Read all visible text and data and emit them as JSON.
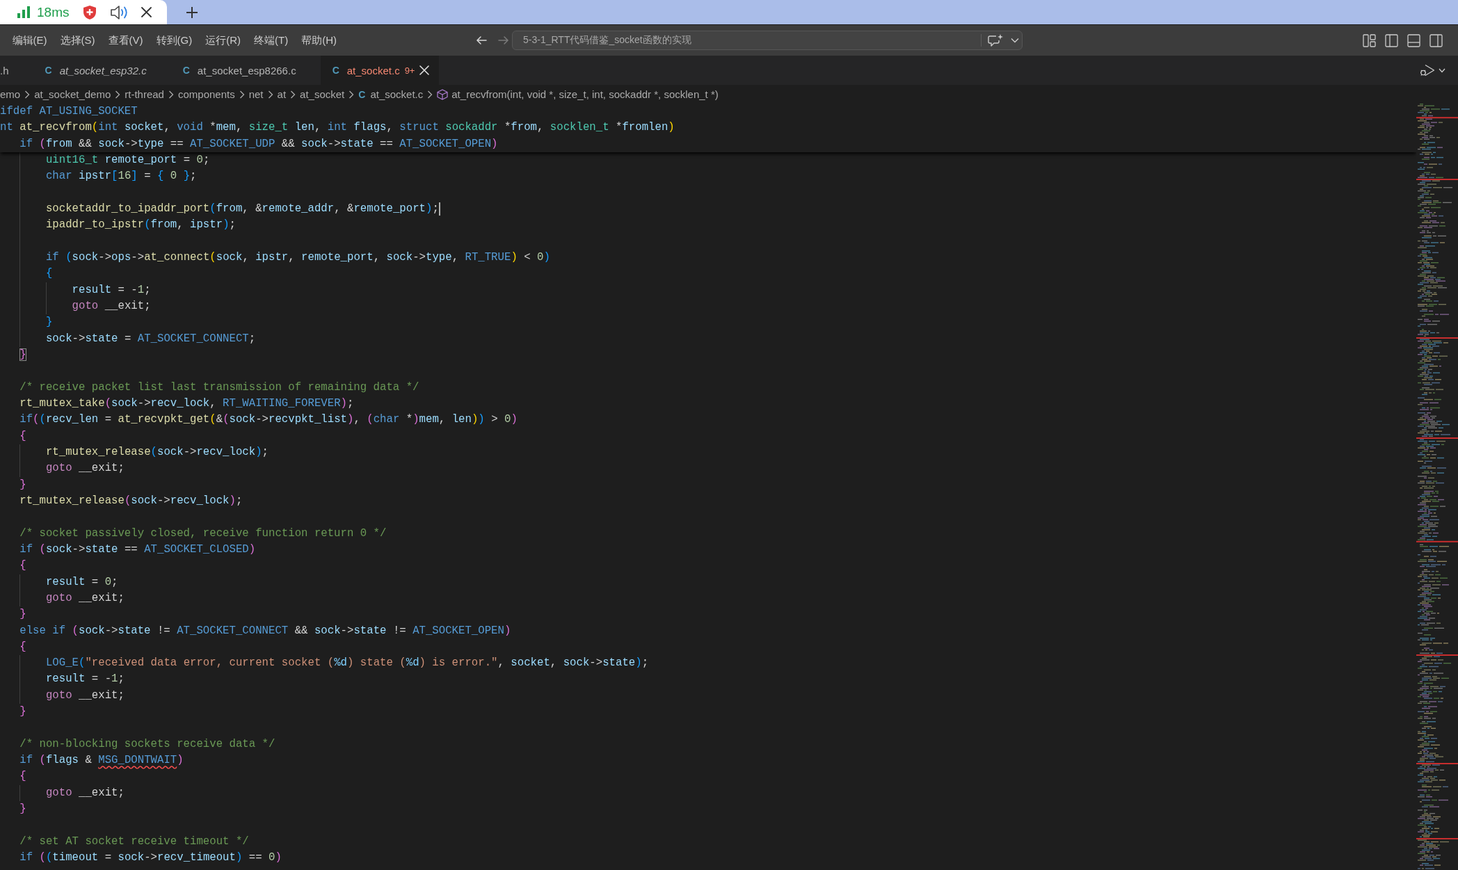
{
  "browser_tab": {
    "latency": "18ms"
  },
  "menu": [
    "编辑(E)",
    "选择(S)",
    "查看(V)",
    "转到(G)",
    "运行(R)",
    "终端(T)",
    "帮助(H)"
  ],
  "navigation": [
    {
      "kind": "back",
      "disabled": false
    },
    {
      "kind": "forward",
      "disabled": true
    }
  ],
  "command_center": {
    "title": "5-3-1_RTT代码借鉴_socket函数的实现"
  },
  "tabs": [
    {
      "label": ".h",
      "selected": false,
      "preview": false,
      "errors": false
    },
    {
      "icon": "C",
      "label": "at_socket_esp32.c",
      "selected": false,
      "preview": true,
      "errors": false
    },
    {
      "icon": "C",
      "label": "at_socket_esp8266.c",
      "selected": false,
      "preview": false,
      "errors": false
    },
    {
      "icon": "C",
      "label": "at_socket.c",
      "problems": "9+",
      "selected": true,
      "preview": false,
      "errors": true
    }
  ],
  "breadcrumbs": [
    {
      "kind": "folder",
      "label": "emo"
    },
    {
      "kind": "folder",
      "label": "at_socket_demo"
    },
    {
      "kind": "folder",
      "label": "rt-thread"
    },
    {
      "kind": "folder",
      "label": "components"
    },
    {
      "kind": "folder",
      "label": "net"
    },
    {
      "kind": "folder",
      "label": "at"
    },
    {
      "kind": "folder",
      "label": "at_socket"
    },
    {
      "kind": "file",
      "icon": "C",
      "label": "at_socket.c"
    },
    {
      "kind": "symbol",
      "label": "at_recvfrom(int, void *, size_t, int, sockaddr *, socklen_t *)"
    }
  ],
  "editor": {
    "sticky_lines": [
      {
        "tokens": [
          {
            "kind": "kw",
            "text": "ifdef AT_USING_SOCKET"
          }
        ]
      },
      {
        "tokens": [
          {
            "kind": "kw",
            "text": "nt "
          },
          {
            "kind": "fn",
            "text": "at_recvfrom"
          },
          {
            "kind": "b1",
            "text": "("
          },
          {
            "kind": "kw",
            "text": "int "
          },
          {
            "kind": "var",
            "text": "socket"
          },
          {
            "kind": "plain",
            "text": ", "
          },
          {
            "kind": "kw",
            "text": "void"
          },
          {
            "kind": "plain",
            "text": " *"
          },
          {
            "kind": "var",
            "text": "mem"
          },
          {
            "kind": "plain",
            "text": ", "
          },
          {
            "kind": "type",
            "text": "size_t "
          },
          {
            "kind": "var",
            "text": "len"
          },
          {
            "kind": "plain",
            "text": ", "
          },
          {
            "kind": "kw",
            "text": "int "
          },
          {
            "kind": "var",
            "text": "flags"
          },
          {
            "kind": "plain",
            "text": ", "
          },
          {
            "kind": "kw",
            "text": "struct "
          },
          {
            "kind": "type",
            "text": "sockaddr"
          },
          {
            "kind": "plain",
            "text": " *"
          },
          {
            "kind": "var",
            "text": "from"
          },
          {
            "kind": "plain",
            "text": ", "
          },
          {
            "kind": "type",
            "text": "socklen_t"
          },
          {
            "kind": "plain",
            "text": " *"
          },
          {
            "kind": "var",
            "text": "fromlen"
          },
          {
            "kind": "b1",
            "text": ")"
          }
        ]
      },
      {
        "tokens": [
          {
            "kind": "kw",
            "text": "   if "
          },
          {
            "kind": "b2",
            "text": "("
          },
          {
            "kind": "var",
            "text": "from"
          },
          {
            "kind": "plain",
            "text": " && "
          },
          {
            "kind": "var",
            "text": "sock"
          },
          {
            "kind": "plain",
            "text": "->"
          },
          {
            "kind": "var",
            "text": "type"
          },
          {
            "kind": "plain",
            "text": " == "
          },
          {
            "kind": "kw",
            "text": "AT_SOCKET_UDP"
          },
          {
            "kind": "plain",
            "text": " && "
          },
          {
            "kind": "var",
            "text": "sock"
          },
          {
            "kind": "plain",
            "text": "->"
          },
          {
            "kind": "var",
            "text": "state"
          },
          {
            "kind": "plain",
            "text": " == "
          },
          {
            "kind": "kw",
            "text": "AT_SOCKET_OPEN"
          },
          {
            "kind": "b2",
            "text": ")"
          }
        ]
      }
    ],
    "lines": [
      {
        "current": false,
        "tokens": [
          {
            "kind": "type",
            "text": "       uint16_t "
          },
          {
            "kind": "var",
            "text": "remote_port"
          },
          {
            "kind": "plain",
            "text": " = "
          },
          {
            "kind": "num",
            "text": "0"
          },
          {
            "kind": "plain",
            "text": ";"
          }
        ]
      },
      {
        "current": false,
        "tokens": [
          {
            "kind": "kw",
            "text": "       char "
          },
          {
            "kind": "var",
            "text": "ipstr"
          },
          {
            "kind": "b3",
            "text": "["
          },
          {
            "kind": "num",
            "text": "16"
          },
          {
            "kind": "b3",
            "text": "]"
          },
          {
            "kind": "plain",
            "text": " = "
          },
          {
            "kind": "b3",
            "text": "{"
          },
          {
            "kind": "num",
            "text": " 0 "
          },
          {
            "kind": "b3",
            "text": "}"
          },
          {
            "kind": "plain",
            "text": ";"
          }
        ]
      },
      {
        "current": false
      },
      {
        "current": true,
        "tokens": [
          {
            "kind": "fn",
            "text": "       socketaddr_to_ipaddr_port"
          },
          {
            "kind": "b3",
            "text": "("
          },
          {
            "kind": "var",
            "text": "from"
          },
          {
            "kind": "plain",
            "text": ", &"
          },
          {
            "kind": "var",
            "text": "remote_addr"
          },
          {
            "kind": "plain",
            "text": ", &"
          },
          {
            "kind": "var",
            "text": "remote_port"
          },
          {
            "kind": "b3",
            "text": ")"
          },
          {
            "kind": "plain",
            "text": ";"
          }
        ]
      },
      {
        "current": false,
        "tokens": [
          {
            "kind": "fn",
            "text": "       ipaddr_to_ipstr"
          },
          {
            "kind": "b3",
            "text": "("
          },
          {
            "kind": "var",
            "text": "from"
          },
          {
            "kind": "plain",
            "text": ", "
          },
          {
            "kind": "var",
            "text": "ipstr"
          },
          {
            "kind": "b3",
            "text": ")"
          },
          {
            "kind": "plain",
            "text": ";"
          }
        ]
      },
      {
        "current": false
      },
      {
        "current": false,
        "tokens": [
          {
            "kind": "kw",
            "text": "       if "
          },
          {
            "kind": "b3",
            "text": "("
          },
          {
            "kind": "var",
            "text": "sock"
          },
          {
            "kind": "plain",
            "text": "->"
          },
          {
            "kind": "var",
            "text": "ops"
          },
          {
            "kind": "plain",
            "text": "->"
          },
          {
            "kind": "fn",
            "text": "at_connect"
          },
          {
            "kind": "b1",
            "text": "("
          },
          {
            "kind": "var",
            "text": "sock"
          },
          {
            "kind": "plain",
            "text": ", "
          },
          {
            "kind": "var",
            "text": "ipstr"
          },
          {
            "kind": "plain",
            "text": ", "
          },
          {
            "kind": "var",
            "text": "remote_port"
          },
          {
            "kind": "plain",
            "text": ", "
          },
          {
            "kind": "var",
            "text": "sock"
          },
          {
            "kind": "plain",
            "text": "->"
          },
          {
            "kind": "var",
            "text": "type"
          },
          {
            "kind": "plain",
            "text": ", "
          },
          {
            "kind": "kw",
            "text": "RT_TRUE"
          },
          {
            "kind": "b1",
            "text": ")"
          },
          {
            "kind": "plain",
            "text": " < "
          },
          {
            "kind": "num",
            "text": "0"
          },
          {
            "kind": "b3",
            "text": ")"
          }
        ]
      },
      {
        "current": false,
        "tokens": [
          {
            "kind": "b3",
            "text": "       {"
          }
        ]
      },
      {
        "current": false,
        "tokens": [
          {
            "kind": "var",
            "text": "           result"
          },
          {
            "kind": "plain",
            "text": " = -"
          },
          {
            "kind": "num",
            "text": "1"
          },
          {
            "kind": "plain",
            "text": ";"
          }
        ]
      },
      {
        "current": false,
        "tokens": [
          {
            "kind": "ctl",
            "text": "           goto"
          },
          {
            "kind": "plain",
            "text": " __exit;"
          }
        ]
      },
      {
        "current": false,
        "tokens": [
          {
            "kind": "b3",
            "text": "       }"
          }
        ]
      },
      {
        "current": false,
        "tokens": [
          {
            "kind": "var",
            "text": "       sock"
          },
          {
            "kind": "plain",
            "text": "->"
          },
          {
            "kind": "var",
            "text": "state"
          },
          {
            "kind": "plain",
            "text": " = "
          },
          {
            "kind": "kw",
            "text": "AT_SOCKET_CONNECT"
          },
          {
            "kind": "plain",
            "text": ";"
          }
        ]
      },
      {
        "current": false,
        "tokens": [
          {
            "kind": "match",
            "text": "   }"
          }
        ]
      },
      {
        "current": false
      },
      {
        "current": false,
        "tokens": [
          {
            "kind": "cmt",
            "text": "   /* receive packet list last transmission of remaining data */"
          }
        ]
      },
      {
        "current": false,
        "tokens": [
          {
            "kind": "fn",
            "text": "   rt_mutex_take"
          },
          {
            "kind": "b2",
            "text": "("
          },
          {
            "kind": "var",
            "text": "sock"
          },
          {
            "kind": "plain",
            "text": "->"
          },
          {
            "kind": "var",
            "text": "recv_lock"
          },
          {
            "kind": "plain",
            "text": ", "
          },
          {
            "kind": "kw",
            "text": "RT_WAITING_FOREVER"
          },
          {
            "kind": "b2",
            "text": ")"
          },
          {
            "kind": "plain",
            "text": ";"
          }
        ]
      },
      {
        "current": false,
        "tokens": [
          {
            "kind": "kw",
            "text": "   if"
          },
          {
            "kind": "b2",
            "text": "("
          },
          {
            "kind": "b3",
            "text": "("
          },
          {
            "kind": "var",
            "text": "recv_len"
          },
          {
            "kind": "plain",
            "text": " = "
          },
          {
            "kind": "fn",
            "text": "at_recvpkt_get"
          },
          {
            "kind": "b1",
            "text": "("
          },
          {
            "kind": "plain",
            "text": "&"
          },
          {
            "kind": "b2",
            "text": "("
          },
          {
            "kind": "var",
            "text": "sock"
          },
          {
            "kind": "plain",
            "text": "->"
          },
          {
            "kind": "var",
            "text": "recvpkt_list"
          },
          {
            "kind": "b2",
            "text": ")"
          },
          {
            "kind": "plain",
            "text": ", "
          },
          {
            "kind": "b2",
            "text": "("
          },
          {
            "kind": "kw",
            "text": "char"
          },
          {
            "kind": "plain",
            "text": " *"
          },
          {
            "kind": "b2",
            "text": ")"
          },
          {
            "kind": "var",
            "text": "mem"
          },
          {
            "kind": "plain",
            "text": ", "
          },
          {
            "kind": "var",
            "text": "len"
          },
          {
            "kind": "b1",
            "text": ")"
          },
          {
            "kind": "b3",
            "text": ")"
          },
          {
            "kind": "plain",
            "text": " > "
          },
          {
            "kind": "num",
            "text": "0"
          },
          {
            "kind": "b2",
            "text": ")"
          }
        ]
      },
      {
        "current": false,
        "tokens": [
          {
            "kind": "b2",
            "text": "   {"
          }
        ]
      },
      {
        "current": false,
        "tokens": [
          {
            "kind": "fn",
            "text": "       rt_mutex_release"
          },
          {
            "kind": "b3",
            "text": "("
          },
          {
            "kind": "var",
            "text": "sock"
          },
          {
            "kind": "plain",
            "text": "->"
          },
          {
            "kind": "var",
            "text": "recv_lock"
          },
          {
            "kind": "b3",
            "text": ")"
          },
          {
            "kind": "plain",
            "text": ";"
          }
        ]
      },
      {
        "current": false,
        "tokens": [
          {
            "kind": "ctl",
            "text": "       goto"
          },
          {
            "kind": "plain",
            "text": " __exit;"
          }
        ]
      },
      {
        "current": false,
        "tokens": [
          {
            "kind": "b2",
            "text": "   }"
          }
        ]
      },
      {
        "current": false,
        "tokens": [
          {
            "kind": "fn",
            "text": "   rt_mutex_release"
          },
          {
            "kind": "b2",
            "text": "("
          },
          {
            "kind": "var",
            "text": "sock"
          },
          {
            "kind": "plain",
            "text": "->"
          },
          {
            "kind": "var",
            "text": "recv_lock"
          },
          {
            "kind": "b2",
            "text": ")"
          },
          {
            "kind": "plain",
            "text": ";"
          }
        ]
      },
      {
        "current": false
      },
      {
        "current": false,
        "tokens": [
          {
            "kind": "cmt",
            "text": "   /* socket passively closed, receive function return 0 */"
          }
        ]
      },
      {
        "current": false,
        "tokens": [
          {
            "kind": "kw",
            "text": "   if "
          },
          {
            "kind": "b2",
            "text": "("
          },
          {
            "kind": "var",
            "text": "sock"
          },
          {
            "kind": "plain",
            "text": "->"
          },
          {
            "kind": "var",
            "text": "state"
          },
          {
            "kind": "plain",
            "text": " == "
          },
          {
            "kind": "kw",
            "text": "AT_SOCKET_CLOSED"
          },
          {
            "kind": "b2",
            "text": ")"
          }
        ]
      },
      {
        "current": false,
        "tokens": [
          {
            "kind": "b2",
            "text": "   {"
          }
        ]
      },
      {
        "current": false,
        "tokens": [
          {
            "kind": "var",
            "text": "       result"
          },
          {
            "kind": "plain",
            "text": " = "
          },
          {
            "kind": "num",
            "text": "0"
          },
          {
            "kind": "plain",
            "text": ";"
          }
        ]
      },
      {
        "current": false,
        "tokens": [
          {
            "kind": "ctl",
            "text": "       goto"
          },
          {
            "kind": "plain",
            "text": " __exit;"
          }
        ]
      },
      {
        "current": false,
        "tokens": [
          {
            "kind": "b2",
            "text": "   }"
          }
        ]
      },
      {
        "current": false,
        "tokens": [
          {
            "kind": "kw",
            "text": "   else if "
          },
          {
            "kind": "b2",
            "text": "("
          },
          {
            "kind": "var",
            "text": "sock"
          },
          {
            "kind": "plain",
            "text": "->"
          },
          {
            "kind": "var",
            "text": "state"
          },
          {
            "kind": "plain",
            "text": " != "
          },
          {
            "kind": "kw",
            "text": "AT_SOCKET_CONNECT"
          },
          {
            "kind": "plain",
            "text": " && "
          },
          {
            "kind": "var",
            "text": "sock"
          },
          {
            "kind": "plain",
            "text": "->"
          },
          {
            "kind": "var",
            "text": "state"
          },
          {
            "kind": "plain",
            "text": " != "
          },
          {
            "kind": "kw",
            "text": "AT_SOCKET_OPEN"
          },
          {
            "kind": "b2",
            "text": ")"
          }
        ]
      },
      {
        "current": false,
        "tokens": [
          {
            "kind": "b2",
            "text": "   {"
          }
        ]
      },
      {
        "current": false,
        "tokens": [
          {
            "kind": "kw",
            "text": "       LOG_E"
          },
          {
            "kind": "b3",
            "text": "("
          },
          {
            "kind": "str",
            "text": "\"received data error, current socket ("
          },
          {
            "kind": "fmt",
            "text": "%d"
          },
          {
            "kind": "str",
            "text": ") state ("
          },
          {
            "kind": "fmt",
            "text": "%d"
          },
          {
            "kind": "str",
            "text": ") is error.\""
          },
          {
            "kind": "plain",
            "text": ", "
          },
          {
            "kind": "var",
            "text": "socket"
          },
          {
            "kind": "plain",
            "text": ", "
          },
          {
            "kind": "var",
            "text": "sock"
          },
          {
            "kind": "plain",
            "text": "->"
          },
          {
            "kind": "var",
            "text": "state"
          },
          {
            "kind": "b3",
            "text": ")"
          },
          {
            "kind": "plain",
            "text": ";"
          }
        ]
      },
      {
        "current": false,
        "tokens": [
          {
            "kind": "var",
            "text": "       result"
          },
          {
            "kind": "plain",
            "text": " = -"
          },
          {
            "kind": "num",
            "text": "1"
          },
          {
            "kind": "plain",
            "text": ";"
          }
        ]
      },
      {
        "current": false,
        "tokens": [
          {
            "kind": "ctl",
            "text": "       goto"
          },
          {
            "kind": "plain",
            "text": " __exit;"
          }
        ]
      },
      {
        "current": false,
        "tokens": [
          {
            "kind": "b2",
            "text": "   }"
          }
        ]
      },
      {
        "current": false
      },
      {
        "current": false,
        "tokens": [
          {
            "kind": "cmt",
            "text": "   /* non-blocking sockets receive data */"
          }
        ]
      },
      {
        "current": false,
        "tokens": [
          {
            "kind": "kw",
            "text": "   if "
          },
          {
            "kind": "b2",
            "text": "("
          },
          {
            "kind": "var",
            "text": "flags"
          },
          {
            "kind": "plain",
            "text": " & "
          },
          {
            "kind": "err",
            "text": "MSG_DONTWAIT"
          },
          {
            "kind": "b2",
            "text": ")"
          }
        ]
      },
      {
        "current": false,
        "tokens": [
          {
            "kind": "b2",
            "text": "   {"
          }
        ]
      },
      {
        "current": false,
        "tokens": [
          {
            "kind": "ctl",
            "text": "       goto"
          },
          {
            "kind": "plain",
            "text": " __exit;"
          }
        ]
      },
      {
        "current": false,
        "tokens": [
          {
            "kind": "b2",
            "text": "   }"
          }
        ]
      },
      {
        "current": false
      },
      {
        "current": false,
        "tokens": [
          {
            "kind": "cmt",
            "text": "   /* set AT socket receive timeout */"
          }
        ]
      },
      {
        "current": false,
        "tokens": [
          {
            "kind": "kw",
            "text": "   if "
          },
          {
            "kind": "b2",
            "text": "("
          },
          {
            "kind": "b3",
            "text": "("
          },
          {
            "kind": "var",
            "text": "timeout"
          },
          {
            "kind": "plain",
            "text": " = "
          },
          {
            "kind": "var",
            "text": "sock"
          },
          {
            "kind": "plain",
            "text": "->"
          },
          {
            "kind": "var",
            "text": "recv_timeout"
          },
          {
            "kind": "b3",
            "text": ")"
          },
          {
            "kind": "plain",
            "text": " == "
          },
          {
            "kind": "num",
            "text": "0"
          },
          {
            "kind": "b2",
            "text": ")"
          }
        ]
      }
    ]
  }
}
